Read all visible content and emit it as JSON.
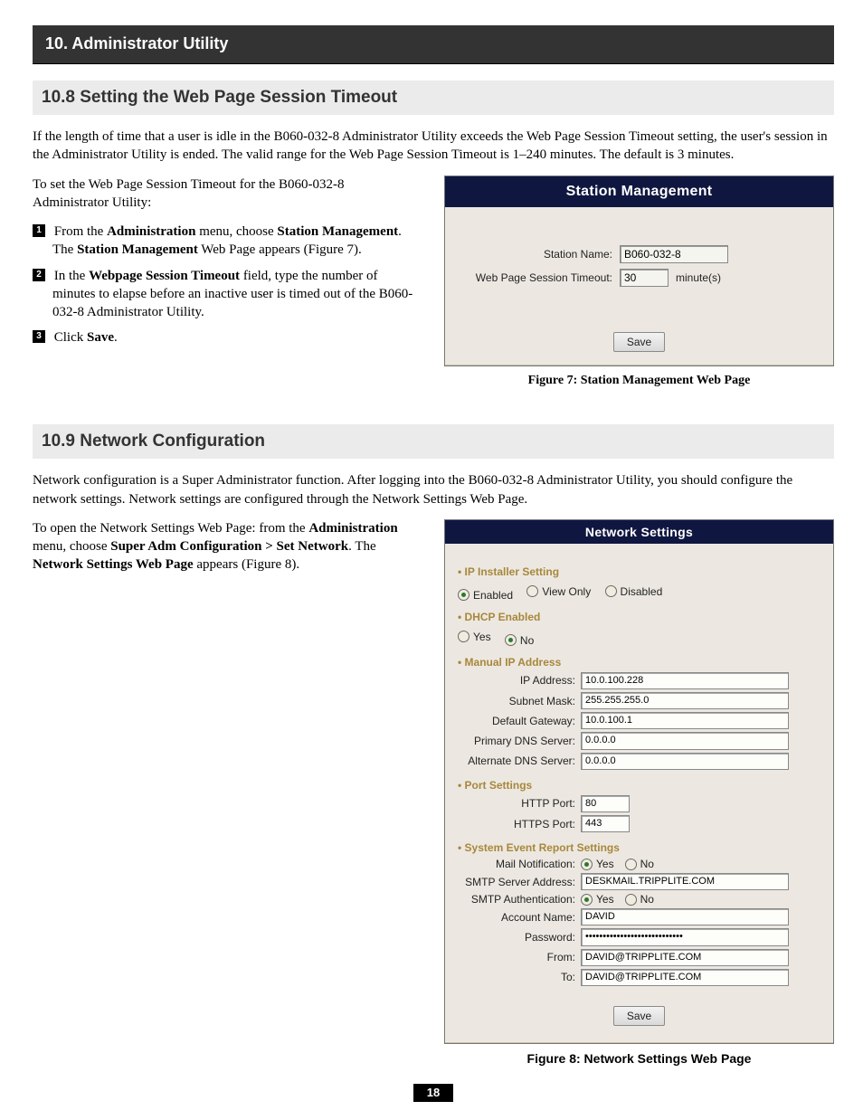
{
  "banner": "10. Administrator Utility",
  "s108": {
    "heading": "10.8 Setting the Web Page Session Timeout",
    "intro": "If the length of time that a user is idle in the B060-032-8 Administrator Utility exceeds the Web Page Session Timeout setting, the user's session in the Administrator Utility is ended. The valid range for the Web Page Session Timeout is 1–240 minutes. The default is 3 minutes.",
    "lead": "To set the Web Page Session Timeout for the B060-032-8 Administrator Utility:",
    "step1_a": "From the ",
    "step1_b": "Administration",
    "step1_c": " menu, choose ",
    "step1_d": "Station Management",
    "step1_e": ". The ",
    "step1_f": "Station Management",
    "step1_g": " Web Page appears (Figure 7).",
    "step2_a": "In the ",
    "step2_b": "Webpage Session Timeout",
    "step2_c": " field, type the number of minutes to elapse before an inactive user is timed out of the B060-032-8 Administrator Utility.",
    "step3_a": "Click ",
    "step3_b": "Save",
    "step3_c": ".",
    "fig": {
      "title": "Station Management",
      "station_label": "Station Name:",
      "station_value": "B060-032-8",
      "timeout_label": "Web Page Session Timeout:",
      "timeout_value": "30",
      "timeout_unit": "minute(s)",
      "save": "Save",
      "caption": "Figure 7: Station Management Web Page"
    }
  },
  "s109": {
    "heading": "10.9 Network Configuration",
    "intro": "Network configuration is a Super Administrator function. After logging into the B060-032-8 Administrator Utility, you should configure the network settings. Network settings are configured through the Network Settings Web Page.",
    "open_a": "To open the Network Settings Web Page: from the ",
    "open_b": "Administration",
    "open_c": " menu, choose ",
    "open_d": "Super Adm Configuration > Set Network",
    "open_e": ". The ",
    "open_f": "Network Settings Web Page",
    "open_g": " appears (Figure 8).",
    "fig": {
      "title": "Network Settings",
      "ip_installer": "IP Installer Setting",
      "enabled": "Enabled",
      "viewonly": "View Only",
      "disabled": "Disabled",
      "dhcp": "DHCP Enabled",
      "yes": "Yes",
      "no": "No",
      "manual": "Manual IP Address",
      "ip_label": "IP Address:",
      "ip_val": "10.0.100.228",
      "mask_label": "Subnet Mask:",
      "mask_val": "255.255.255.0",
      "gw_label": "Default Gateway:",
      "gw_val": "10.0.100.1",
      "pdns_label": "Primary DNS Server:",
      "pdns_val": "0.0.0.0",
      "adns_label": "Alternate DNS Server:",
      "adns_val": "0.0.0.0",
      "ports": "Port Settings",
      "http_label": "HTTP Port:",
      "http_val": "80",
      "https_label": "HTTPS Port:",
      "https_val": "443",
      "sys": "System Event Report Settings",
      "mail_label": "Mail Notification:",
      "smtp_label": "SMTP Server Address:",
      "smtp_val": "DESKMAIL.TRIPPLITE.COM",
      "auth_label": "SMTP Authentication:",
      "acct_label": "Account Name:",
      "acct_val": "DAVID",
      "pwd_label": "Password:",
      "pwd_val": "••••••••••••••••••••••••••••",
      "from_label": "From:",
      "from_val": "DAVID@TRIPPLITE.COM",
      "to_label": "To:",
      "to_val": "DAVID@TRIPPLITE.COM",
      "save": "Save",
      "caption": "Figure 8: Network Settings Web Page"
    }
  },
  "page_number": "18"
}
